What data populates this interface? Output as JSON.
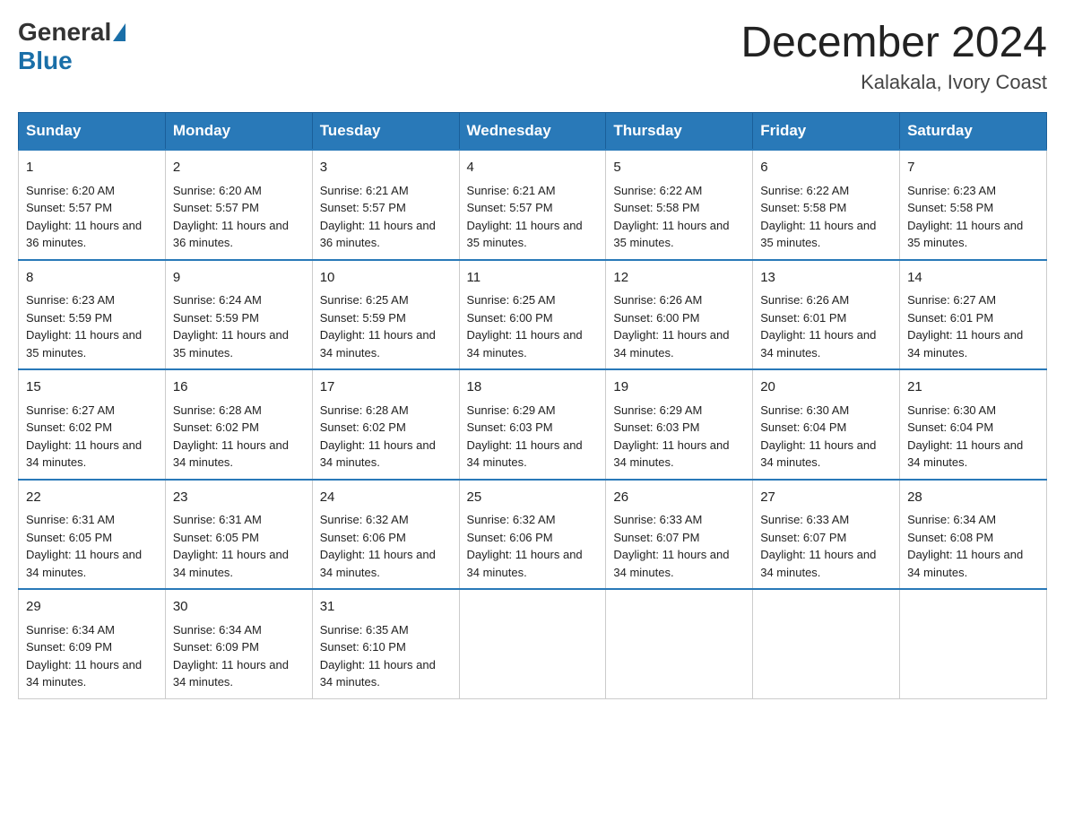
{
  "header": {
    "logo": {
      "general_text": "General",
      "blue_text": "Blue"
    },
    "title": "December 2024",
    "location": "Kalakala, Ivory Coast"
  },
  "days_of_week": [
    "Sunday",
    "Monday",
    "Tuesday",
    "Wednesday",
    "Thursday",
    "Friday",
    "Saturday"
  ],
  "weeks": [
    [
      {
        "day": "1",
        "sunrise": "6:20 AM",
        "sunset": "5:57 PM",
        "daylight": "11 hours and 36 minutes."
      },
      {
        "day": "2",
        "sunrise": "6:20 AM",
        "sunset": "5:57 PM",
        "daylight": "11 hours and 36 minutes."
      },
      {
        "day": "3",
        "sunrise": "6:21 AM",
        "sunset": "5:57 PM",
        "daylight": "11 hours and 36 minutes."
      },
      {
        "day": "4",
        "sunrise": "6:21 AM",
        "sunset": "5:57 PM",
        "daylight": "11 hours and 35 minutes."
      },
      {
        "day": "5",
        "sunrise": "6:22 AM",
        "sunset": "5:58 PM",
        "daylight": "11 hours and 35 minutes."
      },
      {
        "day": "6",
        "sunrise": "6:22 AM",
        "sunset": "5:58 PM",
        "daylight": "11 hours and 35 minutes."
      },
      {
        "day": "7",
        "sunrise": "6:23 AM",
        "sunset": "5:58 PM",
        "daylight": "11 hours and 35 minutes."
      }
    ],
    [
      {
        "day": "8",
        "sunrise": "6:23 AM",
        "sunset": "5:59 PM",
        "daylight": "11 hours and 35 minutes."
      },
      {
        "day": "9",
        "sunrise": "6:24 AM",
        "sunset": "5:59 PM",
        "daylight": "11 hours and 35 minutes."
      },
      {
        "day": "10",
        "sunrise": "6:25 AM",
        "sunset": "5:59 PM",
        "daylight": "11 hours and 34 minutes."
      },
      {
        "day": "11",
        "sunrise": "6:25 AM",
        "sunset": "6:00 PM",
        "daylight": "11 hours and 34 minutes."
      },
      {
        "day": "12",
        "sunrise": "6:26 AM",
        "sunset": "6:00 PM",
        "daylight": "11 hours and 34 minutes."
      },
      {
        "day": "13",
        "sunrise": "6:26 AM",
        "sunset": "6:01 PM",
        "daylight": "11 hours and 34 minutes."
      },
      {
        "day": "14",
        "sunrise": "6:27 AM",
        "sunset": "6:01 PM",
        "daylight": "11 hours and 34 minutes."
      }
    ],
    [
      {
        "day": "15",
        "sunrise": "6:27 AM",
        "sunset": "6:02 PM",
        "daylight": "11 hours and 34 minutes."
      },
      {
        "day": "16",
        "sunrise": "6:28 AM",
        "sunset": "6:02 PM",
        "daylight": "11 hours and 34 minutes."
      },
      {
        "day": "17",
        "sunrise": "6:28 AM",
        "sunset": "6:02 PM",
        "daylight": "11 hours and 34 minutes."
      },
      {
        "day": "18",
        "sunrise": "6:29 AM",
        "sunset": "6:03 PM",
        "daylight": "11 hours and 34 minutes."
      },
      {
        "day": "19",
        "sunrise": "6:29 AM",
        "sunset": "6:03 PM",
        "daylight": "11 hours and 34 minutes."
      },
      {
        "day": "20",
        "sunrise": "6:30 AM",
        "sunset": "6:04 PM",
        "daylight": "11 hours and 34 minutes."
      },
      {
        "day": "21",
        "sunrise": "6:30 AM",
        "sunset": "6:04 PM",
        "daylight": "11 hours and 34 minutes."
      }
    ],
    [
      {
        "day": "22",
        "sunrise": "6:31 AM",
        "sunset": "6:05 PM",
        "daylight": "11 hours and 34 minutes."
      },
      {
        "day": "23",
        "sunrise": "6:31 AM",
        "sunset": "6:05 PM",
        "daylight": "11 hours and 34 minutes."
      },
      {
        "day": "24",
        "sunrise": "6:32 AM",
        "sunset": "6:06 PM",
        "daylight": "11 hours and 34 minutes."
      },
      {
        "day": "25",
        "sunrise": "6:32 AM",
        "sunset": "6:06 PM",
        "daylight": "11 hours and 34 minutes."
      },
      {
        "day": "26",
        "sunrise": "6:33 AM",
        "sunset": "6:07 PM",
        "daylight": "11 hours and 34 minutes."
      },
      {
        "day": "27",
        "sunrise": "6:33 AM",
        "sunset": "6:07 PM",
        "daylight": "11 hours and 34 minutes."
      },
      {
        "day": "28",
        "sunrise": "6:34 AM",
        "sunset": "6:08 PM",
        "daylight": "11 hours and 34 minutes."
      }
    ],
    [
      {
        "day": "29",
        "sunrise": "6:34 AM",
        "sunset": "6:09 PM",
        "daylight": "11 hours and 34 minutes."
      },
      {
        "day": "30",
        "sunrise": "6:34 AM",
        "sunset": "6:09 PM",
        "daylight": "11 hours and 34 minutes."
      },
      {
        "day": "31",
        "sunrise": "6:35 AM",
        "sunset": "6:10 PM",
        "daylight": "11 hours and 34 minutes."
      },
      null,
      null,
      null,
      null
    ]
  ]
}
